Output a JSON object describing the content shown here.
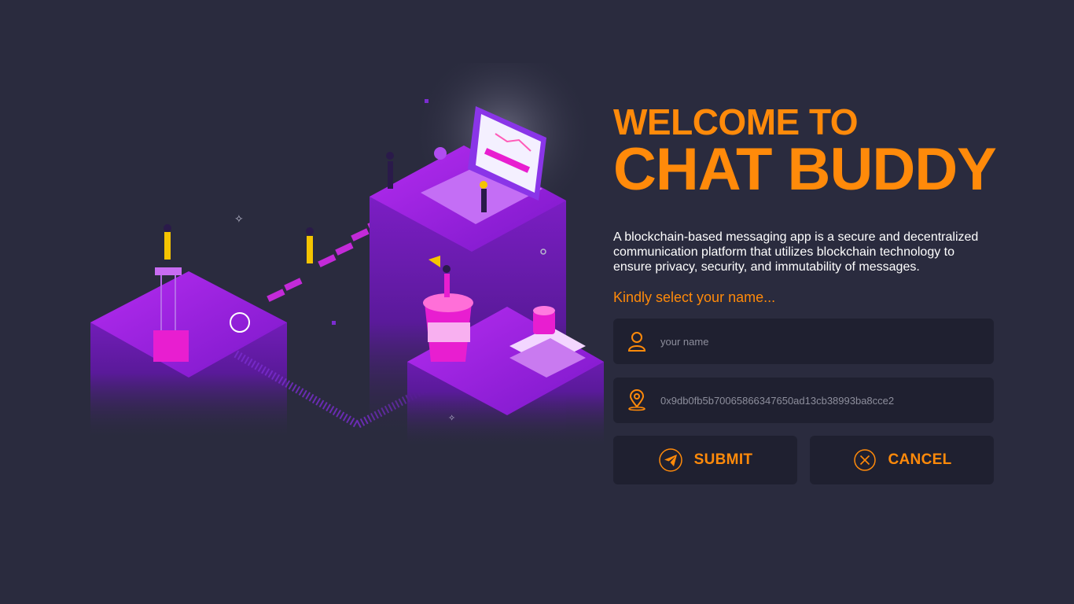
{
  "hero": {
    "welcome_line": "WELCOME TO",
    "brand_line": "CHAT BUDDY",
    "description": "A blockchain-based messaging app is a secure and decentralized communication platform that utilizes blockchain technology to ensure privacy, security, and immutability of messages.",
    "select_prompt": "Kindly select your name..."
  },
  "form": {
    "name_field": {
      "icon": "user-icon",
      "placeholder": "your name",
      "value": ""
    },
    "address_field": {
      "icon": "location-pin-icon",
      "value": "0x9db0fb5b70065866347650ad13cb38993ba8cce2"
    }
  },
  "actions": {
    "submit": {
      "label": "SUBMIT",
      "icon": "send-icon"
    },
    "cancel": {
      "label": "CANCEL",
      "icon": "close-circle-icon"
    }
  },
  "colors": {
    "background": "#2a2b3e",
    "accent": "#ff8a0a",
    "field_background": "#1f2030",
    "illustration_primary": "#9b1fd8",
    "illustration_highlight": "#e81ed0"
  }
}
